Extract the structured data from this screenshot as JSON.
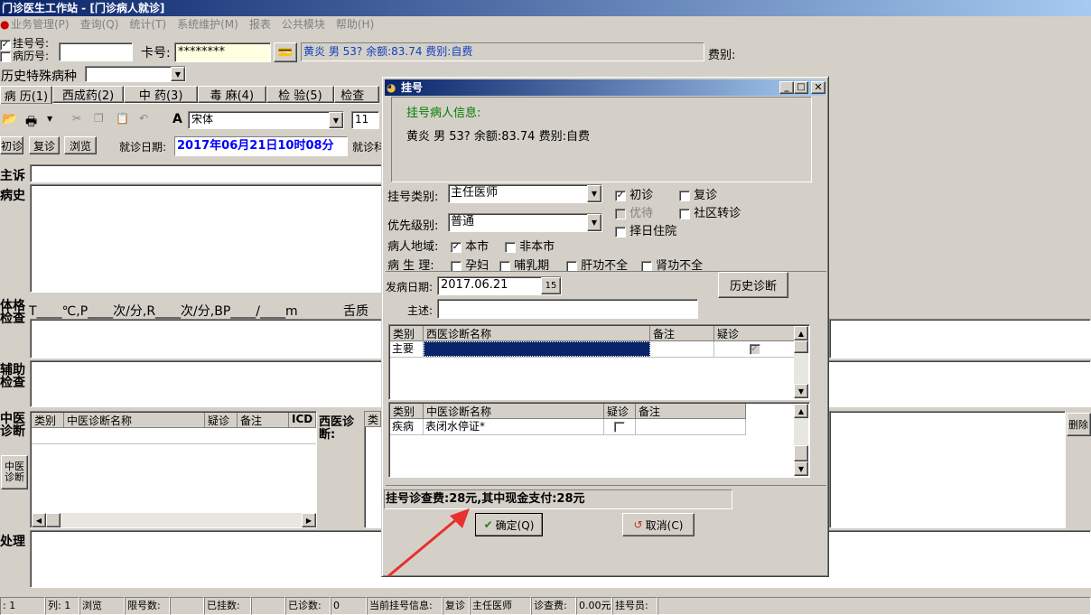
{
  "window": {
    "title": "门诊医生工作站 - [门诊病人就诊]"
  },
  "menu": [
    "业务管理(P)",
    "查询(Q)",
    "统计(T)",
    "系统维护(M)",
    "报表",
    "公共模块",
    "帮助(H)"
  ],
  "header": {
    "reg_label": "挂号号:",
    "record_label": "病历号:",
    "card_label": "卡号:",
    "card_value": "********",
    "patient_info": "黄炎 男 53? 余额:83.74 费别:自费",
    "fee_type_label": "费别:",
    "history_disease_label": "历史特殊病种"
  },
  "tabs": [
    "病 历(1)",
    "西成药(2)",
    "中 药(3)",
    "毒 麻(4)",
    "检 验(5)",
    "检查"
  ],
  "toolbar": {
    "font_name": "宋体",
    "font_size": "11"
  },
  "visit": {
    "first": "初诊",
    "followup": "复诊",
    "browse": "浏览",
    "date_label": "就诊日期:",
    "date_value": "2017年06月21日10时08分",
    "partial": "就诊科"
  },
  "record": {
    "chief_label": "主诉",
    "history_label": "病史",
    "exam_label": "体格检查",
    "vitals": "T____℃,P____次/分,R____次/分,BP____/____m",
    "tongue": "舌质",
    "aux_label": "辅助检查",
    "tcm_label": "中医诊断",
    "tcm_btn": "中医诊断",
    "tcm_cols": [
      "类别",
      "中医诊断名称",
      "疑诊",
      "备注",
      "ICD"
    ],
    "wm_label": "西医诊断:",
    "wm_col": "类",
    "treat_label": "处理",
    "delete_btn": "删除"
  },
  "dialog": {
    "title": "挂号",
    "info_title": "挂号病人信息:",
    "info_text": "黄炎 男 53? 余额:83.74 费别:自费",
    "reg_type_label": "挂号类别:",
    "reg_type_value": "主任医师",
    "priority_label": "优先级别:",
    "priority_value": "普通",
    "region_label": "病人地域:",
    "physio_label": "病 生 理:",
    "cb_first": "初诊",
    "cb_followup": "复诊",
    "cb_priority": "优待",
    "cb_community": "社区转诊",
    "cb_select_day": "择日住院",
    "cb_local": "本市",
    "cb_nonlocal": "非本市",
    "cb_pregnant": "孕妇",
    "cb_lactation": "哺乳期",
    "cb_liver": "肝功不全",
    "cb_kidney": "肾功不全",
    "onset_label": "发病日期:",
    "onset_value": "2017.06.21",
    "history_diag_btn": "历史诊断",
    "chief_label": "主述:",
    "wm_table": {
      "cols": [
        "类别",
        "西医诊断名称",
        "备注",
        "疑诊"
      ],
      "rows": [
        {
          "cat": "主要",
          "name": "",
          "note": ""
        }
      ]
    },
    "tcm_table": {
      "cols": [
        "类别",
        "中医诊断名称",
        "疑诊",
        "备注"
      ],
      "rows": [
        {
          "cat": "疾病",
          "name": "表闭水停证*",
          "note": ""
        }
      ]
    },
    "fee_text": "挂号诊查费:28元,其中现金支付:28元",
    "ok_btn": "确定(Q)",
    "cancel_btn": "取消(C)"
  },
  "status": {
    "line": ": 1",
    "col": "列: 1",
    "browse": "浏览",
    "limit_label": "限号数:",
    "registered_label": "已挂数:",
    "diagnosed_label": "已诊数:",
    "diagnosed_value": "0",
    "current_label": "当前挂号信息:",
    "current_type": "复诊",
    "current_doc": "主任医师",
    "fee_label": "诊查费:",
    "fee_value": "0.00元",
    "staff_label": "挂号员:"
  },
  "colors": {
    "title_blue": "#0a246a",
    "info_green": "#008000",
    "date_blue": "#0000ff",
    "arrow_red": "#e8302e"
  }
}
